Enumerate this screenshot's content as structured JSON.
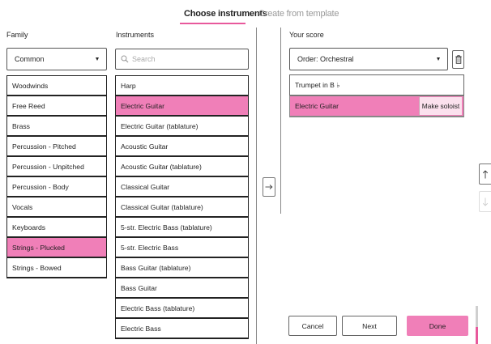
{
  "tabs": {
    "choose": "Choose instruments",
    "template": "Create from template"
  },
  "family": {
    "label": "Family",
    "dropdown_value": "Common",
    "items": [
      {
        "label": "Woodwinds",
        "selected": false
      },
      {
        "label": "Free Reed",
        "selected": false
      },
      {
        "label": "Brass",
        "selected": false
      },
      {
        "label": "Percussion - Pitched",
        "selected": false
      },
      {
        "label": "Percussion - Unpitched",
        "selected": false
      },
      {
        "label": "Percussion - Body",
        "selected": false
      },
      {
        "label": "Vocals",
        "selected": false
      },
      {
        "label": "Keyboards",
        "selected": false
      },
      {
        "label": "Strings - Plucked",
        "selected": true
      },
      {
        "label": "Strings - Bowed",
        "selected": false
      }
    ]
  },
  "instruments": {
    "label": "Instruments",
    "search_placeholder": "Search",
    "items": [
      {
        "label": "Harp",
        "selected": false
      },
      {
        "label": "Electric Guitar",
        "selected": true
      },
      {
        "label": "Electric Guitar (tablature)",
        "selected": false
      },
      {
        "label": "Acoustic Guitar",
        "selected": false
      },
      {
        "label": "Acoustic Guitar (tablature)",
        "selected": false
      },
      {
        "label": "Classical Guitar",
        "selected": false
      },
      {
        "label": "Classical Guitar (tablature)",
        "selected": false
      },
      {
        "label": "5-str. Electric Bass (tablature)",
        "selected": false
      },
      {
        "label": "5-str. Electric Bass",
        "selected": false
      },
      {
        "label": "Bass Guitar (tablature)",
        "selected": false
      },
      {
        "label": "Bass Guitar",
        "selected": false
      },
      {
        "label": "Electric Bass (tablature)",
        "selected": false
      },
      {
        "label": "Electric Bass",
        "selected": false
      }
    ]
  },
  "score": {
    "label": "Your score",
    "order_value": "Order: Orchestral",
    "items": [
      {
        "label": "Trumpet in B ♭",
        "selected": false
      },
      {
        "label": "Electric Guitar",
        "selected": true
      }
    ],
    "make_soloist": "Make soloist"
  },
  "footer": {
    "cancel": "Cancel",
    "next": "Next",
    "done": "Done"
  },
  "icons": {
    "add": "arrow-right-icon",
    "move_up": "arrow-up-icon",
    "move_down": "arrow-down-icon",
    "delete": "trash-icon",
    "search": "search-icon",
    "dropdown": "chevron-down-icon"
  },
  "colors": {
    "accent": "#f07fb8",
    "accent_dark": "#e8599c",
    "soloist_bg": "#fbe1ee"
  }
}
